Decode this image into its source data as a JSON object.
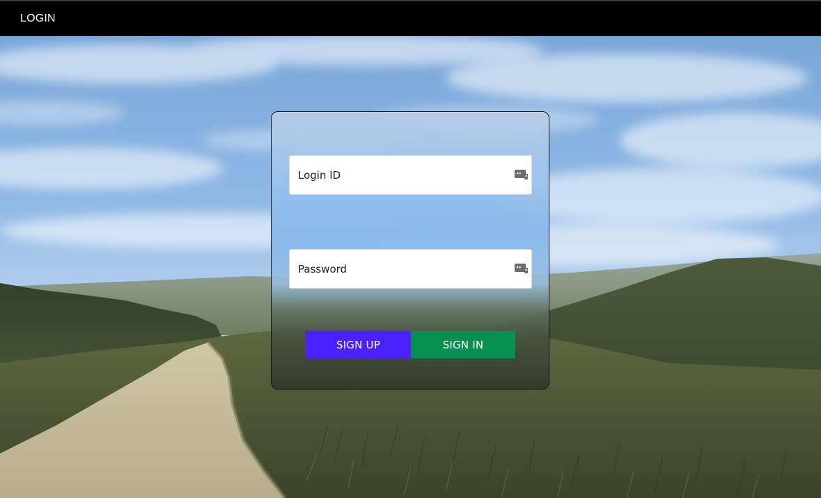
{
  "nav": {
    "title": "LOGIN"
  },
  "form": {
    "login_id": {
      "placeholder": "Login ID",
      "value": "",
      "icon": "password-manager-key-icon"
    },
    "password": {
      "placeholder": "Password",
      "value": "",
      "icon": "password-manager-key-icon"
    },
    "buttons": {
      "signup_label": "SIGN UP",
      "signin_label": "SIGN IN"
    }
  },
  "colors": {
    "topbar": "#000000",
    "signup_button": "#4a20ff",
    "signin_button": "#0a9152",
    "input_background": "#ffffff"
  },
  "background": {
    "icon": "landscape-photo"
  }
}
